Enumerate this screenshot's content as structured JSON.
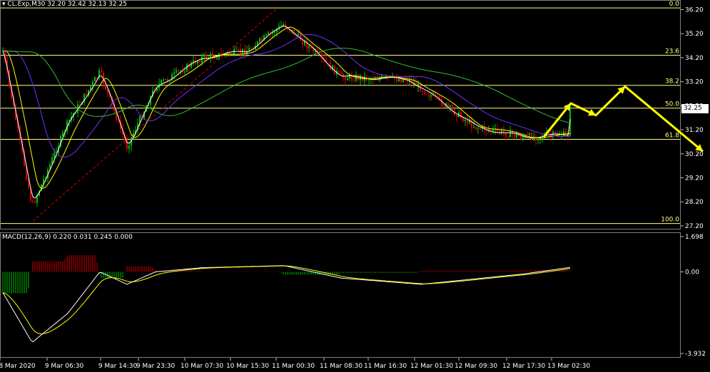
{
  "header": {
    "symbol": "CL.Exp,M30",
    "ohlc": "32.20 32.42 32.13 32.25"
  },
  "macd": {
    "title": "MACD(12,26,9) 0.220 0.031 0.245 0.000",
    "axis": [
      "1.698",
      "0.00",
      "-3.932"
    ]
  },
  "current_price": "32.25",
  "colors": {
    "background": "#000000",
    "bull": "#00c000",
    "bear": "#d00000",
    "fib": "#ffff80",
    "ma_fast": "#ffffff",
    "ma_mid": "#ffff00",
    "ma_slow": "#7030ff",
    "ma_long": "#30c030",
    "projection": "#ffff00"
  },
  "chart_data": [
    {
      "type": "candlestick",
      "title": "CL.Exp,M30",
      "y_ticks": [
        "36.20",
        "35.20",
        "34.20",
        "33.20",
        "32.20",
        "31.20",
        "30.20",
        "29.20",
        "28.20",
        "27.20"
      ],
      "ylim": [
        27.2,
        36.6
      ],
      "x_ticks": [
        "8 Mar 2020",
        "9 Mar 06:30",
        "9 Mar 14:30",
        "9 Mar 23:30",
        "10 Mar 07:30",
        "10 Mar 15:30",
        "11 Mar 00:30",
        "11 Mar 08:30",
        "11 Mar 16:30",
        "12 Mar 01:30",
        "12 Mar 09:30",
        "12 Mar 17:30",
        "13 Mar 02:30"
      ],
      "fib_levels": [
        {
          "label": "0.0",
          "price": 36.27
        },
        {
          "label": "23.6",
          "price": 34.3
        },
        {
          "label": "38.2",
          "price": 33.05
        },
        {
          "label": "50.0",
          "price": 32.1
        },
        {
          "label": "61.8",
          "price": 30.8
        },
        {
          "label": "100.0",
          "price": 27.3
        }
      ],
      "anchor_points": [
        {
          "x": "8 Mar 2020",
          "price": 27.4
        },
        {
          "x": "11 Mar 00:30",
          "price": 36.27
        }
      ],
      "close_profile": [
        {
          "x": "8 Mar 2020",
          "price": 34.5
        },
        {
          "x": "8 Mar 2020",
          "price": 28.0
        },
        {
          "x": "9 Mar 06:30",
          "price": 31.5
        },
        {
          "x": "9 Mar 14:30",
          "price": 33.6
        },
        {
          "x": "9 Mar 14:30",
          "price": 30.5
        },
        {
          "x": "9 Mar 23:30",
          "price": 33.0
        },
        {
          "x": "10 Mar 07:30",
          "price": 34.2
        },
        {
          "x": "10 Mar 15:30",
          "price": 34.5
        },
        {
          "x": "11 Mar 00:30",
          "price": 35.6
        },
        {
          "x": "11 Mar 08:30",
          "price": 33.4
        },
        {
          "x": "11 Mar 16:30",
          "price": 33.3
        },
        {
          "x": "12 Mar 01:30",
          "price": 31.3
        },
        {
          "x": "12 Mar 09:30",
          "price": 30.9
        },
        {
          "x": "12 Mar 17:30",
          "price": 31.0
        },
        {
          "x": "13 Mar 02:30",
          "price": 32.25
        }
      ],
      "projection": [
        {
          "price": 30.9
        },
        {
          "price": 32.3
        },
        {
          "price": 31.8
        },
        {
          "price": 33.0
        },
        {
          "price": 30.3
        }
      ]
    },
    {
      "type": "macd",
      "title": "MACD(12,26,9) 0.220 0.031 0.245 0.000",
      "ylim": [
        -3.932,
        1.698
      ],
      "y_ticks": [
        "1.698",
        "0.00",
        "-3.932"
      ],
      "macd_line_profile": [
        {
          "x": "8 Mar 2020",
          "v": -1.0
        },
        {
          "x": "8 Mar 2020",
          "v": -3.4
        },
        {
          "x": "9 Mar 06:30",
          "v": -2.0
        },
        {
          "x": "9 Mar 14:30",
          "v": 0.0
        },
        {
          "x": "9 Mar 14:30",
          "v": -0.6
        },
        {
          "x": "9 Mar 23:30",
          "v": 0.0
        },
        {
          "x": "10 Mar 07:30",
          "v": 0.2
        },
        {
          "x": "11 Mar 00:30",
          "v": 0.3
        },
        {
          "x": "11 Mar 08:30",
          "v": -0.3
        },
        {
          "x": "12 Mar 01:30",
          "v": -0.6
        },
        {
          "x": "12 Mar 17:30",
          "v": -0.1
        },
        {
          "x": "13 Mar 02:30",
          "v": 0.22
        }
      ]
    }
  ]
}
